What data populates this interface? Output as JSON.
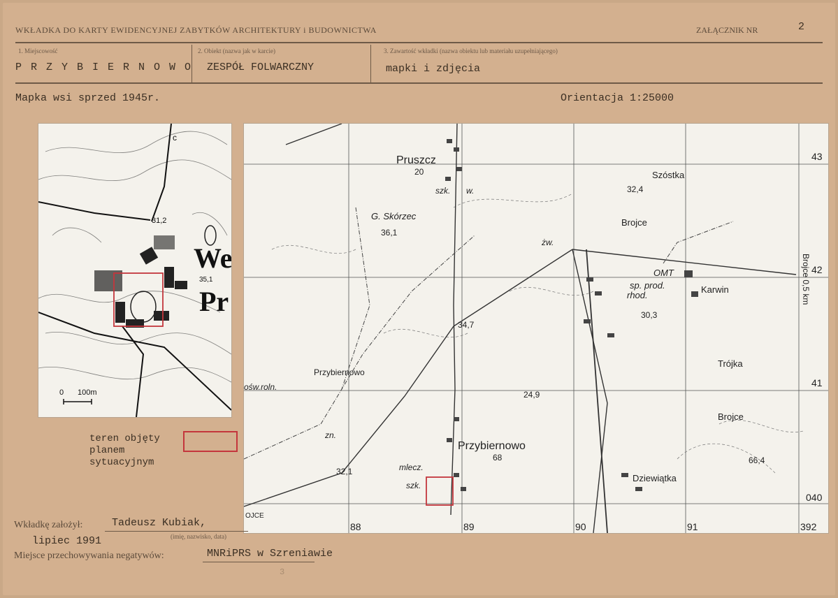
{
  "header": {
    "title": "WKŁADKA DO KARTY EWIDENCYJNEJ ZABYTKÓW ARCHITEKTURY i BUDOWNICTWA",
    "attachment_label": "ZAŁĄCZNIK NR",
    "attachment_number": "2"
  },
  "fields": {
    "f1_label": "1. Miejscowość",
    "f1_value": "P R Z Y B I E R N O W O",
    "f2_label": "2. Obiekt (nazwa jak w karcie)",
    "f2_value": "ZESPÓŁ FOLWARCZNY",
    "f3_label": "3. Zawartość wkładki (nazwa obiektu lub materiału uzupełniającego)",
    "f3_value": "mapki i zdjęcia"
  },
  "captions": {
    "left": "Mapka wsi sprzed 1945r.",
    "right": "Orientacja 1:25000"
  },
  "small_map": {
    "labels": [
      "We",
      "Pr",
      "31,2",
      "35,1",
      "c",
      "0",
      "100m"
    ]
  },
  "big_map": {
    "places": [
      "Pruszcz",
      "20",
      "szk.",
      "w.",
      "G. Skórzec",
      "36,1",
      "Szóstka",
      "32,4",
      "Brojce",
      "żw.",
      "OMT",
      "sp. prod.",
      "rhod.",
      "Karwin",
      "30,3",
      "Brojce 0,5 km",
      "34,7",
      "Przybiernowo",
      "ośw.roln.",
      "24,9",
      "Trójka",
      "Brojce",
      "zn.",
      "Przybiernowo",
      "68",
      "mlecz.",
      "szk.",
      "32,1",
      "Dziewiątka",
      "66,4",
      "OJCE"
    ],
    "grid_x": [
      "88",
      "89",
      "90",
      "91",
      "392"
    ],
    "grid_y": [
      "43",
      "42",
      "41",
      "040"
    ]
  },
  "legend": {
    "line1": "teren objęty",
    "line2": "planem",
    "line3": "sytuacyjnym"
  },
  "footer": {
    "made_by_label": "Wkładkę założył:",
    "made_by_value": "Tadeusz Kubiak,",
    "made_by_hint": "(imię, nazwisko, data)",
    "date": "lipiec 1991",
    "storage_label": "Miejsce przechowywania negatywów:",
    "storage_value": "MNRiPRS w Szreniawie",
    "stamp": "3"
  },
  "colors": {
    "paper": "#d3b08f",
    "map_bg": "#f4f2ec",
    "marker": "#c4363c"
  }
}
